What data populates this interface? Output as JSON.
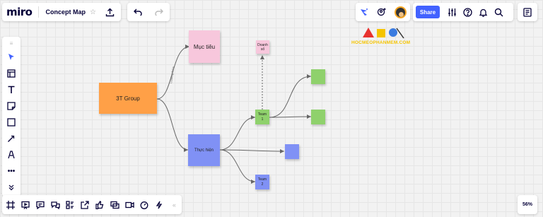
{
  "app": {
    "logo": "miro",
    "board_title": "Concept Map"
  },
  "toolbar_right": {
    "share_label": "Share"
  },
  "zoom": {
    "level": "56%"
  },
  "watermark": {
    "text": "HOCMEOPHANMEM.COM"
  },
  "canvas": {
    "nodes": {
      "group": "3T Group",
      "goal": "Mục tiêu",
      "revenue": "Doanh số",
      "execution": "Thực hiện",
      "team1": "Team 1",
      "team2": "Team 2"
    },
    "connector_label": "Leading force"
  },
  "colors": {
    "orange": "#ffa047",
    "pink": "#f7c7dc",
    "blue": "#8091f5",
    "green": "#8fd16c",
    "accent": "#4262ff"
  },
  "icons": {
    "left_toolbar": [
      "collapse-icon",
      "select-cursor-icon",
      "templates-icon",
      "text-icon",
      "sticky-note-icon",
      "shape-icon",
      "pen-line-icon",
      "pen-icon",
      "more-icon",
      "expand-down-icon"
    ],
    "bottom_bar": [
      "frames-icon",
      "presentation-icon",
      "comments-icon",
      "chat-icon",
      "cards-icon",
      "export-icon",
      "reactions-icon",
      "screen-share-icon",
      "video-icon",
      "timer-icon",
      "voting-icon",
      "collapse-left-icon"
    ]
  }
}
